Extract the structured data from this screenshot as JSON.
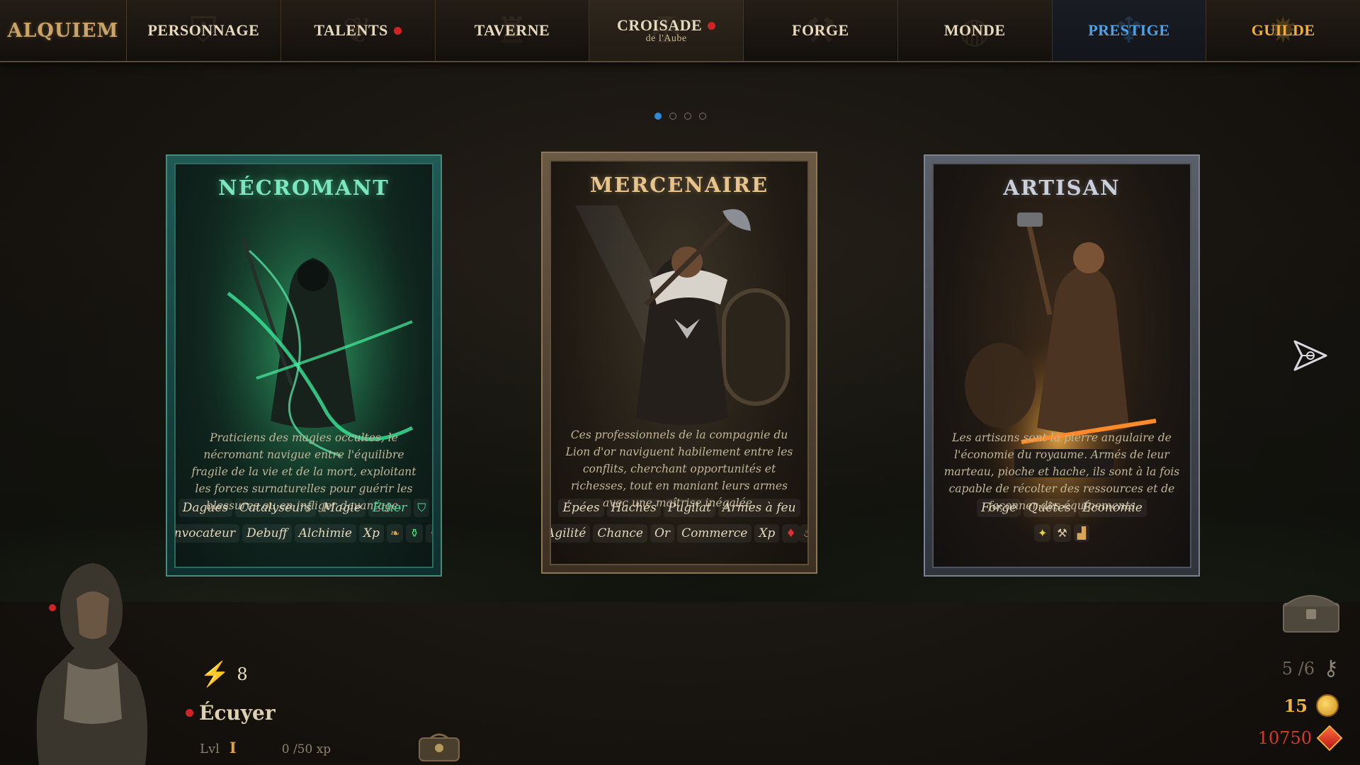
{
  "app": {
    "logo": "ALQUIEM"
  },
  "nav": {
    "items": [
      {
        "label": "PERSONNAGE",
        "icon": "helmet-icon",
        "notification": false
      },
      {
        "label": "TALENTS",
        "icon": "wings-icon",
        "notification": true
      },
      {
        "label": "TAVERNE",
        "icon": "mug-icon",
        "notification": false
      },
      {
        "label": "CROISADE",
        "sublabel": "de l'Aube",
        "icon": "cross-icon",
        "notification": true
      },
      {
        "label": "FORGE",
        "icon": "anvil-icon",
        "notification": false
      },
      {
        "label": "MONDE",
        "icon": "globe-icon",
        "notification": false
      },
      {
        "label": "PRESTIGE",
        "icon": "eagle-icon",
        "notification": false,
        "color": "#4aa3e8"
      },
      {
        "label": "GUILDE",
        "icon": "sun-icon",
        "notification": false,
        "color": "#f0b03a"
      }
    ]
  },
  "pager": {
    "pages": 4,
    "active": 1
  },
  "cards": {
    "necromant": {
      "title": "NÉCROMANT",
      "description": "Praticiens des magies occultes, le nécromant navigue entre l'équilibre fragile de la vie et de la mort, exploitant les forces surnaturelles pour guérir les blessures ou en infliger davantage.",
      "tags_row1": [
        "Dagues",
        "Catalyseurs",
        "Magie",
        "Éther"
      ],
      "tags_row2": [
        "Invocateur",
        "Debuff",
        "Alchimie",
        "Xp"
      ]
    },
    "mercenaire": {
      "title": "MERCENAIRE",
      "description": "Ces professionnels de la compagnie du Lion d'or naviguent habilement entre les conflits, cherchant opportunités et richesses, tout en maniant leurs armes avec une maîtrise inégalée.",
      "tags_row1": [
        "Épées",
        "Haches",
        "Pugilat",
        "Armes à feu"
      ],
      "tags_row2": [
        "Agilité",
        "Chance",
        "Or",
        "Commerce",
        "Xp"
      ]
    },
    "artisan": {
      "title": "ARTISAN",
      "description": "Les artisans sont la pierre angulaire de l'économie du royaume. Armés de leur marteau, pioche et hache, ils sont à la fois capable de récolter des ressources et de façonner des équipements",
      "tags_row1": [
        "Forge",
        "Quêtes",
        "Économie"
      ]
    }
  },
  "player": {
    "energy": "8",
    "rank": "Écuyer",
    "level_label": "Lvl",
    "level": "I",
    "xp": "0 /50 xp"
  },
  "resources": {
    "keys": "5 /6",
    "coins": "15",
    "gems": "10750"
  },
  "colors": {
    "accent_red": "#d02424",
    "prestige_blue": "#4aa3e8",
    "guild_gold": "#f0b03a",
    "pager_active": "#2c8cd8"
  }
}
